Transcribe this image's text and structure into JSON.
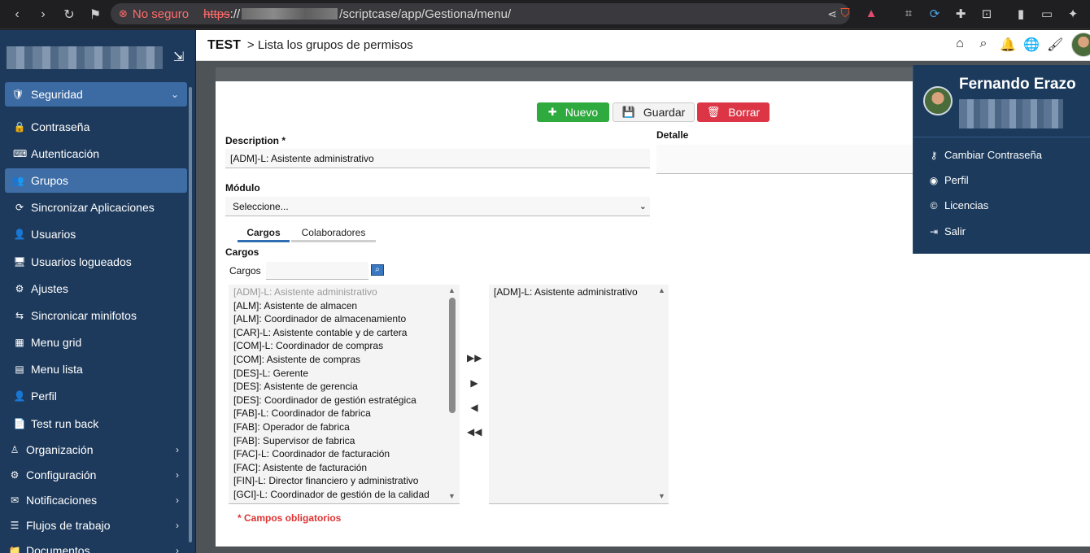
{
  "browser": {
    "nosec": "No seguro",
    "https": "https",
    "sep": "://",
    "path": "/scriptcase/app/Gestiona/menu/"
  },
  "sidebar": {
    "items": [
      {
        "label": "Seguridad",
        "icon": "shield-icon",
        "glyph": "🛡",
        "type": "section"
      },
      {
        "label": "Contraseña",
        "icon": "lock-icon",
        "glyph": "🔒",
        "type": "sub"
      },
      {
        "label": "Autenticación",
        "icon": "keyboard-icon",
        "glyph": "⌨",
        "type": "sub"
      },
      {
        "label": "Grupos",
        "icon": "group-icon",
        "glyph": "👥",
        "type": "active"
      },
      {
        "label": "Sincronizar Aplicaciones",
        "icon": "sync-icon",
        "glyph": "⟳",
        "type": "sub"
      },
      {
        "label": "Usuarios",
        "icon": "user-icon",
        "glyph": "👤",
        "type": "sub"
      },
      {
        "label": "Usuarios logueados",
        "icon": "monitor-icon",
        "glyph": "🖥",
        "type": "sub"
      },
      {
        "label": "Ajustes",
        "icon": "gear-icon",
        "glyph": "⚙",
        "type": "sub"
      },
      {
        "label": "Sincronicar minifotos",
        "icon": "people-sync-icon",
        "glyph": "⇆",
        "type": "sub"
      },
      {
        "label": "Menu grid",
        "icon": "grid-icon",
        "glyph": "▦",
        "type": "sub"
      },
      {
        "label": "Menu lista",
        "icon": "list-icon",
        "glyph": "▤",
        "type": "sub"
      },
      {
        "label": "Perfil",
        "icon": "profile-icon",
        "glyph": "👤",
        "type": "sub"
      },
      {
        "label": "Test run back",
        "icon": "document-icon",
        "glyph": "📄",
        "type": "sub"
      },
      {
        "label": "Organización",
        "icon": "org-icon",
        "glyph": "♙",
        "type": "parent"
      },
      {
        "label": "Configuración",
        "icon": "settings-icon",
        "glyph": "⚙",
        "type": "parent"
      },
      {
        "label": "Notificaciones",
        "icon": "notification-icon",
        "glyph": "✉",
        "type": "parent"
      },
      {
        "label": "Flujos de trabajo",
        "icon": "workflow-icon",
        "glyph": "☰",
        "type": "parent"
      },
      {
        "label": "Documentos",
        "icon": "documents-icon",
        "glyph": "📁",
        "type": "parent"
      }
    ]
  },
  "topbar": {
    "title": "TEST",
    "breadcrumb": "> Lista los grupos de permisos"
  },
  "toolbar": {
    "new_label": "Nuevo",
    "save_label": "Guardar",
    "delete_label": "Borrar"
  },
  "form": {
    "description_label": "Description *",
    "description_value": "[ADM]-L: Asistente administrativo",
    "detalle_label": "Detalle",
    "modulo_label": "Módulo",
    "modulo_value": "Seleccione...",
    "tabs": [
      "Cargos",
      "Colaboradores"
    ],
    "cargos_section": "Cargos",
    "cargos_search_label": "Cargos",
    "required_note": "* Campos obligatorios"
  },
  "available_list": [
    "[ADM]-L: Asistente administrativo",
    "[ALM]: Asistente de almacen",
    "[ALM]: Coordinador de almacenamiento",
    "[CAR]-L: Asistente contable y de cartera",
    "[COM]-L: Coordinador de compras",
    "[COM]: Asistente de compras",
    "[DES]-L: Gerente",
    "[DES]: Asistente de gerencia",
    "[DES]: Coordinador de gestión estratégica",
    "[FAB]-L: Coordinador de fabrica",
    "[FAB]: Operador de fabrica",
    "[FAB]: Supervisor de fabrica",
    "[FAC]-L: Coordinador de facturación",
    "[FAC]: Asistente de facturación",
    "[FIN]-L: Director financiero y administrativo",
    "[GCI]-L: Coordinador de gestión de la calidad"
  ],
  "selected_list": [
    "[ADM]-L: Asistente administrativo"
  ],
  "profile": {
    "name": "Fernando Erazo",
    "items": [
      {
        "label": "Cambiar Contraseña",
        "icon": "key-icon",
        "glyph": "⚷"
      },
      {
        "label": "Perfil",
        "icon": "user-circle-icon",
        "glyph": "◉"
      },
      {
        "label": "Licencias",
        "icon": "copyright-icon",
        "glyph": "©"
      },
      {
        "label": "Salir",
        "icon": "logout-icon",
        "glyph": "⇥"
      }
    ]
  }
}
